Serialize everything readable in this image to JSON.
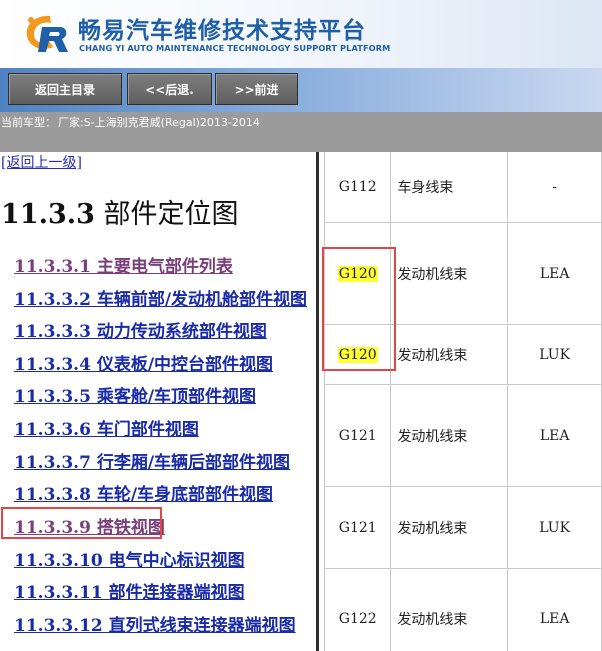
{
  "header": {
    "title": "畅易汽车维修技术支持平台",
    "subtitle": "CHANG YI AUTO MAINTENANCE TECHNOLOGY SUPPORT PLATFORM",
    "logo_icon": "cy-logo-icon"
  },
  "nav": {
    "home": "返回主目录",
    "back": "<<后退.",
    "forward": ">>前进"
  },
  "vehicle": {
    "label": "当前车型：",
    "value": "厂家:S-上海别克君威(Regal)2013-2014"
  },
  "left": {
    "up_link": "[返回上一级]",
    "section_number": "11.3.3",
    "section_title": "部件定位图",
    "items": [
      {
        "label": "11.3.3.1 主要电气部件列表",
        "visited": true
      },
      {
        "label": "11.3.3.2 车辆前部/发动机舱部件视图"
      },
      {
        "label": "11.3.3.3 动力传动系统部件视图"
      },
      {
        "label": "11.3.3.4 仪表板/中控台部件视图"
      },
      {
        "label": "11.3.3.5 乘客舱/车顶部件视图"
      },
      {
        "label": "11.3.3.6 车门部件视图"
      },
      {
        "label": "11.3.3.7 行李厢/车辆后部部件视图"
      },
      {
        "label": "11.3.3.8 车轮/车身底部部件视图"
      },
      {
        "label": "11.3.3.9 搭铁视图",
        "visited": true,
        "highlighted": true
      },
      {
        "label": "11.3.3.10 电气中心标识视图"
      },
      {
        "label": "11.3.3.11 部件连接器端视图"
      },
      {
        "label": "11.3.3.12 直列式线束连接器端视图"
      }
    ]
  },
  "table": {
    "rows": [
      {
        "code": "G112",
        "harness": "车身线束",
        "variant": "-"
      },
      {
        "code": "G120",
        "harness": "发动机线束",
        "variant": "LEA",
        "highlighted": true
      },
      {
        "code": "G120",
        "harness": "发动机线束",
        "variant": "LUK",
        "highlighted": true
      },
      {
        "code": "G121",
        "harness": "发动机线束",
        "variant": "LEA"
      },
      {
        "code": "G121",
        "harness": "发动机线束",
        "variant": "LUK"
      },
      {
        "code": "G122",
        "harness": "发动机线束",
        "variant": "LEA"
      }
    ],
    "highlight_color": "#ffff33",
    "box_color": "#e04848"
  }
}
